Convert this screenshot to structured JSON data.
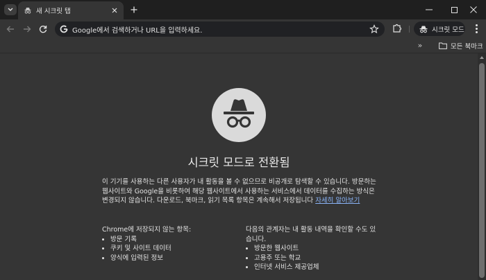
{
  "titlebar": {
    "tab_title": "새 시크릿 탭"
  },
  "toolbar": {
    "omnibox_placeholder": "Google에서 검색하거나 URL을 입력하세요.",
    "incognito_label": "시크릿 모드"
  },
  "bookmarks": {
    "all_bookmarks_label": "모든 북마크"
  },
  "page": {
    "heading": "시크릿 모드로 전환됨",
    "description": "이 기기를 사용하는 다른 사용자가 내 활동을 볼 수 없으므로 비공개로 탐색할 수 있습니다. 방문하는 웹사이트와 Google을 비롯하여 해당 웹사이트에서 사용하는 서비스에서 데이터를 수집하는 방식은 변경되지 않습니다. 다운로드, 북마크, 읽기 목록 항목은 계속해서 저장됩니다 ",
    "learn_more_link": "자세히 알아보기",
    "not_saved": {
      "title": "Chrome에 저장되지 않는 항목:",
      "items": [
        "방문 기록",
        "쿠키 및 사이트 데이터",
        "양식에 입력된 정보"
      ]
    },
    "may_be_visible": {
      "title": "다음의 관계자는 내 활동 내역을 확인할 수도 있습니다.",
      "items": [
        "방문한 웹사이트",
        "고용주 또는 학교",
        "인터넷 서비스 제공업체"
      ]
    }
  },
  "colors": {
    "background": "#353535",
    "titlebar": "#1f1f1f",
    "omnibox": "#202124",
    "link": "#8ab4f8",
    "logo_circle": "#dadada"
  },
  "icons": [
    "tab-search-icon",
    "incognito-icon",
    "close-icon",
    "plus-icon",
    "minimize-icon",
    "maximize-icon",
    "window-close-icon",
    "back-arrow-icon",
    "forward-arrow-icon",
    "reload-icon",
    "google-g-icon",
    "star-icon",
    "extensions-icon",
    "more-vert-icon",
    "chevron-double-right-icon",
    "folder-icon"
  ]
}
